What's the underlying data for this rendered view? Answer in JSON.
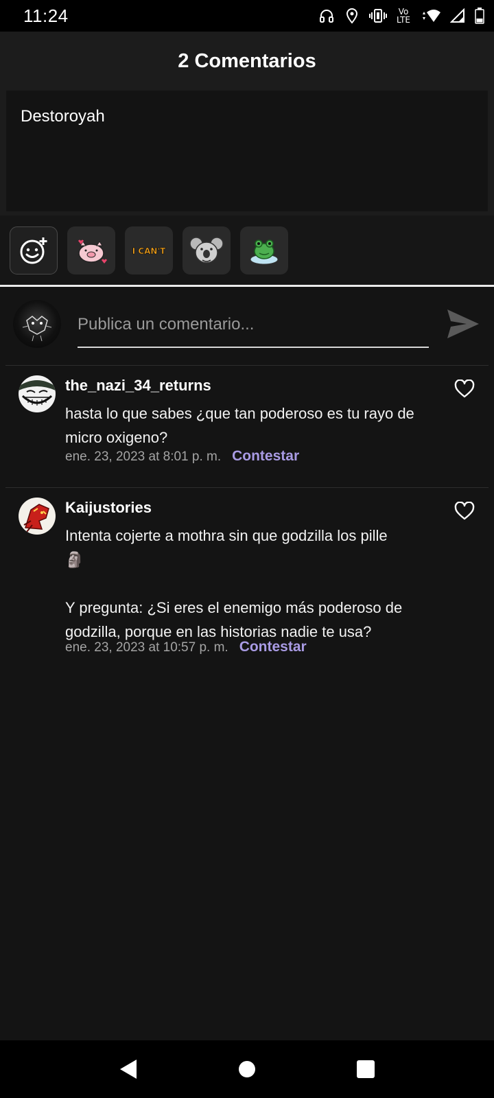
{
  "status_bar": {
    "time": "11:24",
    "lte_top": "Vo",
    "lte_bottom": "LTE",
    "icons": [
      "headphones-icon",
      "location-icon",
      "vibrate-icon",
      "volte-icon",
      "wifi-icon",
      "signal-icon",
      "battery-icon"
    ]
  },
  "header": {
    "title": "2 Comentarios"
  },
  "story": {
    "text": "Destoroyah"
  },
  "stickers": [
    "emoji-add-icon",
    "pig-sticker",
    "i-cant-sticker",
    "koala-sticker",
    "frog-sticker"
  ],
  "sticker_labels": {
    "i_cant": "I CAN'T"
  },
  "composer": {
    "placeholder": "Publica un comentario..."
  },
  "comments": [
    {
      "user": "the_nazi_34_returns",
      "text": "hasta lo que sabes ¿que tan poderoso es tu rayo de micro oxigeno?",
      "date": "ene. 23, 2023 at 8:01 p. m.",
      "reply": "Contestar"
    },
    {
      "user": "Kaijustories",
      "text": "Intenta cojerte a mothra sin que godzilla los pille\n🗿\n\nY pregunta: ¿Si eres el enemigo más poderoso de godzilla, porque en las historias nadie te usa?",
      "date": "ene. 23, 2023 at 10:57 p. m.",
      "reply": "Contestar"
    }
  ],
  "colors": {
    "accent": "#a99be4",
    "background": "#141414",
    "header": "#1c1c1c"
  }
}
